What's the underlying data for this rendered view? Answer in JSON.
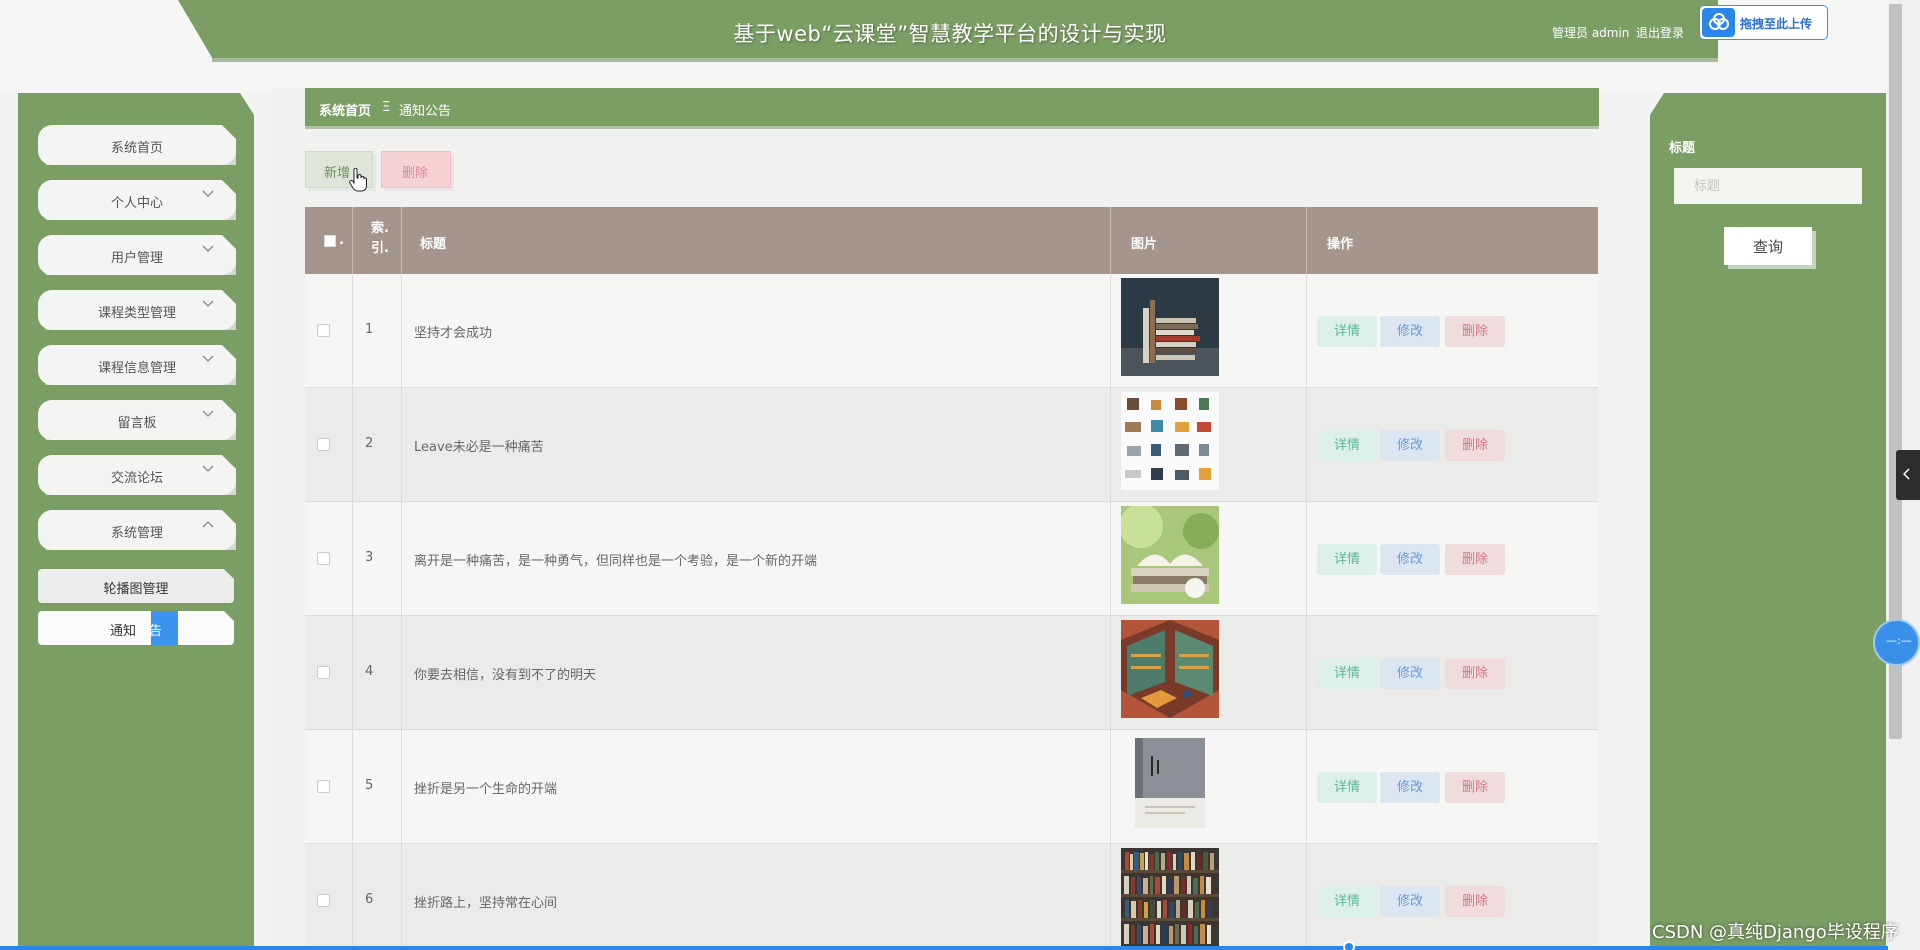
{
  "header": {
    "title": "基于web“云课堂”智慧教学平台的设计与实现",
    "user_info": "管理员 admin",
    "logout": "退出登录",
    "upload_label": "拖拽至此上传",
    "accent_color": "#7b9e64"
  },
  "sidebar": {
    "items": [
      {
        "label": "系统首页",
        "has_arrow": false
      },
      {
        "label": "个人中心",
        "has_arrow": true
      },
      {
        "label": "用户管理",
        "has_arrow": true
      },
      {
        "label": "课程类型管理",
        "has_arrow": true
      },
      {
        "label": "课程信息管理",
        "has_arrow": true
      },
      {
        "label": "留言板",
        "has_arrow": true
      },
      {
        "label": "交流论坛",
        "has_arrow": true
      },
      {
        "label": "系统管理",
        "has_arrow": true,
        "expanded": true
      }
    ],
    "subitems": [
      {
        "label": "轮播图管理"
      },
      {
        "label_prefix": "通知",
        "label_highlight": "公告"
      }
    ]
  },
  "breadcrumb": {
    "home": "系统首页",
    "separator": "Ξ",
    "current": "通知公告"
  },
  "toolbar": {
    "add_label": "新增",
    "delete_label": "删除"
  },
  "table": {
    "headers": {
      "dot": ".",
      "index": "索.引.",
      "title": "标题",
      "image": "图片",
      "operations": "操作"
    },
    "rows": [
      {
        "index": "1",
        "title": "坚持才会成功",
        "thumb": "books-stack-dark"
      },
      {
        "index": "2",
        "title": "Leave未必是一种痛苦",
        "thumb": "library-icons-grid"
      },
      {
        "index": "3",
        "title": "离开是一种痛苦，是一种勇气，但同样也是一个考验，是一个新的开端",
        "thumb": "open-book-plant"
      },
      {
        "index": "4",
        "title": "你要去相信，没有到不了的明天",
        "thumb": "isometric-library-room"
      },
      {
        "index": "5",
        "title": "挫折是另一个生命的开端",
        "thumb": "book-cover-grey"
      },
      {
        "index": "6",
        "title": "挫折路上，坚持常在心间",
        "thumb": "bookshelves-photo"
      }
    ],
    "op_detail": "详情",
    "op_edit": "修改",
    "op_delete": "删除"
  },
  "search": {
    "label": "标题",
    "placeholder": "标题",
    "button": "查询"
  },
  "floating": {
    "circle_text": "—:—"
  },
  "watermark": "CSDN @真纯Django毕设程序"
}
